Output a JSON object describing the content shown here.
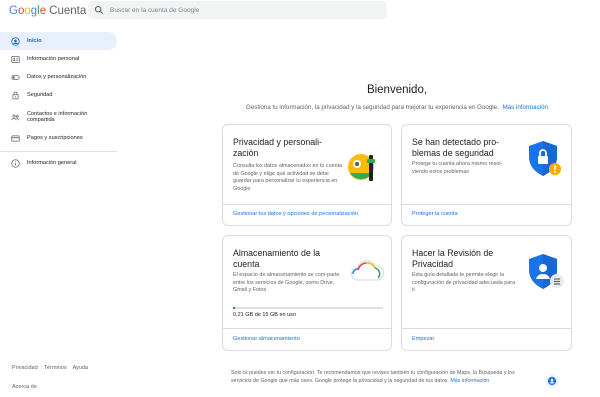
{
  "header": {
    "logo": {
      "g1": "G",
      "o1": "o",
      "o2": "o",
      "g2": "g",
      "l": "l",
      "e": "e",
      "product": "Cuenta"
    },
    "search_placeholder": "Buscar en la cuenta de Google"
  },
  "sidebar": {
    "items": [
      {
        "label": "Inicio",
        "icon": "home-icon"
      },
      {
        "label": "Información personal",
        "icon": "id-card-icon"
      },
      {
        "label": "Datos y personalización",
        "icon": "toggle-icon"
      },
      {
        "label": "Seguridad",
        "icon": "lock-icon"
      },
      {
        "label": "Contactos e información compartida",
        "icon": "people-icon"
      },
      {
        "label": "Pagos y suscripciones",
        "icon": "credit-card-icon"
      },
      {
        "label": "Información general",
        "icon": "info-icon"
      }
    ],
    "footer_links": [
      "Privacidad",
      "Términos",
      "Ayuda"
    ],
    "footer_about": "Acerca de"
  },
  "main": {
    "welcome": "Bienvenido,",
    "subtitle": "Gestiona tu información, la privacidad y la seguridad para mejorar tu experiencia en Google.",
    "subtitle_link": "Más información",
    "cards": {
      "privacy": {
        "title": "Privacidad y personali-zación",
        "description": "Consulta los datos almacenados en tu cuenta de Google y elige qué actividad se debe guardar para personalizar tu experiencia en Google",
        "link": "Gestionar tus datos y opciones de personalización"
      },
      "security": {
        "title": "Se han detectado pro-blemas de seguridad",
        "description": "Protege tu cuenta ahora mismo resol-viendo estos problemas",
        "link": "Proteger la cuenta"
      },
      "storage": {
        "title": "Almacenamiento de la cuenta",
        "description": "El espacio de almacenamiento se com-parte entre los servicios de Google, como Drive, Gmail y Fotos",
        "usage": "0,21 GB de 15 GB en uso",
        "usage_fraction": 0.014,
        "link": "Gestionar almacenamiento"
      },
      "review": {
        "title": "Hacer la Revisión de Privacidad",
        "description": "Esta guía detallada te permite elegir la configuración de privacidad adecuada para ti",
        "link": "Empezar"
      }
    },
    "notice": "Solo tú puedes ver tu configuración. Te recomendamos que revises también tu configuración de Maps, la Búsqueda y los servicios de Google que más uses. Google protege la privacidad y la seguridad de tus datos.",
    "notice_link": "Más información"
  },
  "colors": {
    "accent": "#1a73e8",
    "active_bg": "#e8f0fe",
    "border": "#dadce0",
    "warning": "#f9ab00"
  }
}
